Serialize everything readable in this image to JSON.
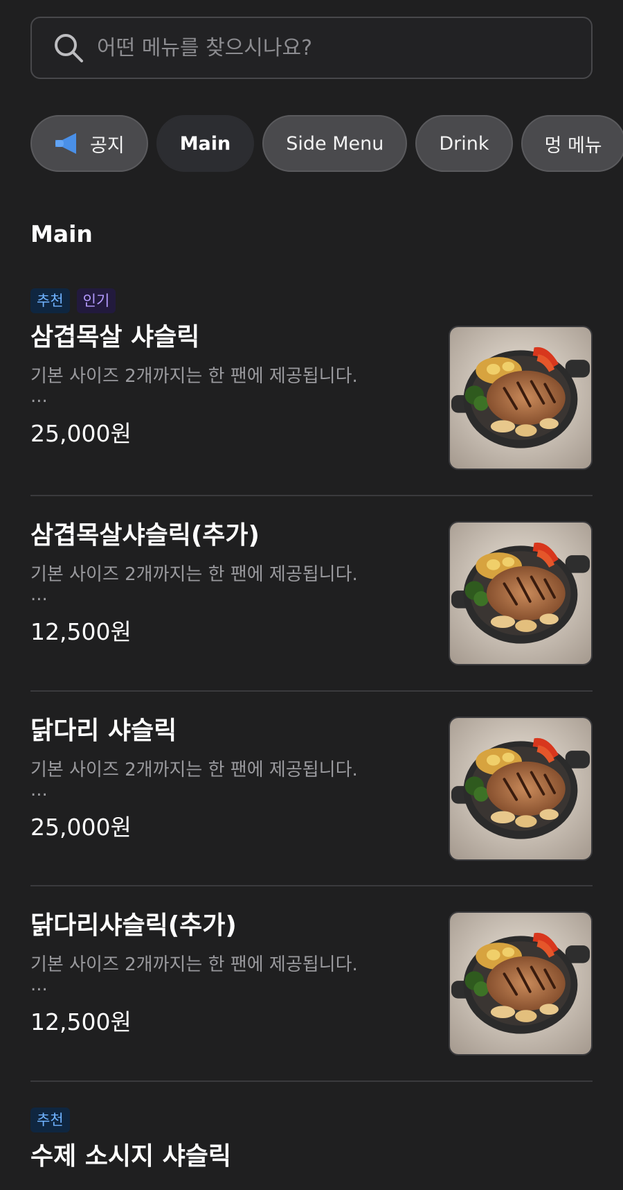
{
  "search": {
    "placeholder": "어떤 메뉴를 찾으시나요?",
    "icon": "search-icon"
  },
  "categories": [
    {
      "label": "공지",
      "icon": "megaphone-icon"
    },
    {
      "label": "Main",
      "active": true
    },
    {
      "label": "Side Menu"
    },
    {
      "label": "Drink"
    },
    {
      "label": "멍 메뉴"
    }
  ],
  "section": {
    "title": "Main"
  },
  "badges": {
    "recommended": "추천",
    "popular": "인기"
  },
  "items": [
    {
      "name": "삼겹목살 샤슬릭",
      "desc": "기본 사이즈 2개까지는 한 팬에 제공됩니다.",
      "more": "...",
      "price": "25,000원",
      "badges": [
        "추천",
        "인기"
      ]
    },
    {
      "name": "삼겹목살샤슬릭(추가)",
      "desc": "기본 사이즈 2개까지는 한 팬에 제공됩니다.",
      "more": "...",
      "price": "12,500원"
    },
    {
      "name": "닭다리 샤슬릭",
      "desc": "기본 사이즈 2개까지는 한 팬에 제공됩니다.",
      "more": "...",
      "price": "25,000원"
    },
    {
      "name": "닭다리샤슬릭(추가)",
      "desc": "기본 사이즈 2개까지는 한 팬에 제공됩니다.",
      "more": "...",
      "price": "12,500원"
    },
    {
      "name": "수제 소시지 샤슬릭",
      "badges": [
        "추천"
      ]
    }
  ],
  "colors": {
    "background": "#1f1f20",
    "chip": "#4a4a4d",
    "chip_active": "#2c2d31",
    "badge_recommended": "#6fb2ff",
    "badge_popular": "#b49bff",
    "megaphone": "#4a90e8"
  }
}
